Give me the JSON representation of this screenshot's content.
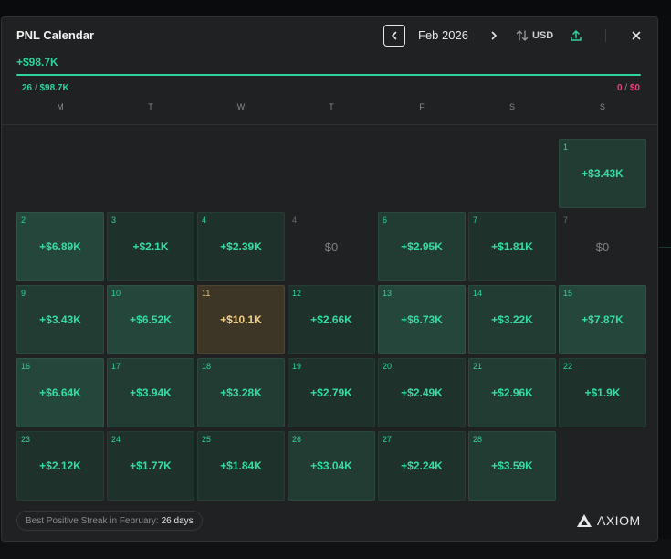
{
  "header": {
    "title": "PNL Calendar",
    "month": "Feb 2026",
    "currency": "USD"
  },
  "summary": {
    "total_pnl": "+$98.7K",
    "progress_fraction": 1.0,
    "positive_days": "26",
    "positive_total": "$98.7K",
    "negative_days": "0",
    "negative_total": "$0",
    "separator": " / "
  },
  "weekdays": [
    "M",
    "T",
    "W",
    "T",
    "F",
    "S",
    "S"
  ],
  "calendar": [
    {
      "day": "",
      "value": "",
      "kind": "empty"
    },
    {
      "day": "",
      "value": "",
      "kind": "empty"
    },
    {
      "day": "",
      "value": "",
      "kind": "empty"
    },
    {
      "day": "",
      "value": "",
      "kind": "empty"
    },
    {
      "day": "",
      "value": "",
      "kind": "empty"
    },
    {
      "day": "",
      "value": "",
      "kind": "empty"
    },
    {
      "day": "1",
      "value": "+$3.43K",
      "kind": "pos",
      "tone": "mid"
    },
    {
      "day": "2",
      "value": "+$6.89K",
      "kind": "pos",
      "tone": "high"
    },
    {
      "day": "3",
      "value": "+$2.1K",
      "kind": "pos",
      "tone": "low"
    },
    {
      "day": "4",
      "value": "+$2.39K",
      "kind": "pos",
      "tone": "low"
    },
    {
      "day": "4",
      "value": "$0",
      "kind": "zero"
    },
    {
      "day": "6",
      "value": "+$2.95K",
      "kind": "pos",
      "tone": "mid"
    },
    {
      "day": "7",
      "value": "+$1.81K",
      "kind": "pos",
      "tone": "low"
    },
    {
      "day": "7",
      "value": "$0",
      "kind": "zero"
    },
    {
      "day": "9",
      "value": "+$3.43K",
      "kind": "pos",
      "tone": "mid"
    },
    {
      "day": "10",
      "value": "+$6.52K",
      "kind": "pos",
      "tone": "high"
    },
    {
      "day": "11",
      "value": "+$10.1K",
      "kind": "best"
    },
    {
      "day": "12",
      "value": "+$2.66K",
      "kind": "pos",
      "tone": "low"
    },
    {
      "day": "13",
      "value": "+$6.73K",
      "kind": "pos",
      "tone": "high"
    },
    {
      "day": "14",
      "value": "+$3.22K",
      "kind": "pos",
      "tone": "mid"
    },
    {
      "day": "15",
      "value": "+$7.87K",
      "kind": "pos",
      "tone": "high"
    },
    {
      "day": "16",
      "value": "+$6.64K",
      "kind": "pos",
      "tone": "high"
    },
    {
      "day": "17",
      "value": "+$3.94K",
      "kind": "pos",
      "tone": "mid"
    },
    {
      "day": "18",
      "value": "+$3.28K",
      "kind": "pos",
      "tone": "mid"
    },
    {
      "day": "19",
      "value": "+$2.79K",
      "kind": "pos",
      "tone": "low"
    },
    {
      "day": "20",
      "value": "+$2.49K",
      "kind": "pos",
      "tone": "low"
    },
    {
      "day": "21",
      "value": "+$2.96K",
      "kind": "pos",
      "tone": "mid"
    },
    {
      "day": "22",
      "value": "+$1.9K",
      "kind": "pos",
      "tone": "low"
    },
    {
      "day": "23",
      "value": "+$2.12K",
      "kind": "pos",
      "tone": "low"
    },
    {
      "day": "24",
      "value": "+$1.77K",
      "kind": "pos",
      "tone": "low"
    },
    {
      "day": "25",
      "value": "+$1.84K",
      "kind": "pos",
      "tone": "low"
    },
    {
      "day": "26",
      "value": "+$3.04K",
      "kind": "pos",
      "tone": "mid"
    },
    {
      "day": "27",
      "value": "+$2.24K",
      "kind": "pos",
      "tone": "low"
    },
    {
      "day": "28",
      "value": "+$3.59K",
      "kind": "pos",
      "tone": "mid"
    },
    {
      "day": "",
      "value": "",
      "kind": "empty"
    }
  ],
  "footer": {
    "streak_label": "Best Positive Streak in February:",
    "streak_value": "26 days",
    "brand": "AXIOM"
  },
  "colors": {
    "accent_green": "#2fd39c",
    "negative_red": "#e0467a",
    "best_day_gold": "#f0cf85"
  },
  "icons": {
    "prev": "chevron-left-icon",
    "next": "chevron-right-icon",
    "currency": "swap-vertical-icon",
    "share": "upload-icon",
    "close": "close-icon",
    "brand": "axiom-logo-icon"
  }
}
